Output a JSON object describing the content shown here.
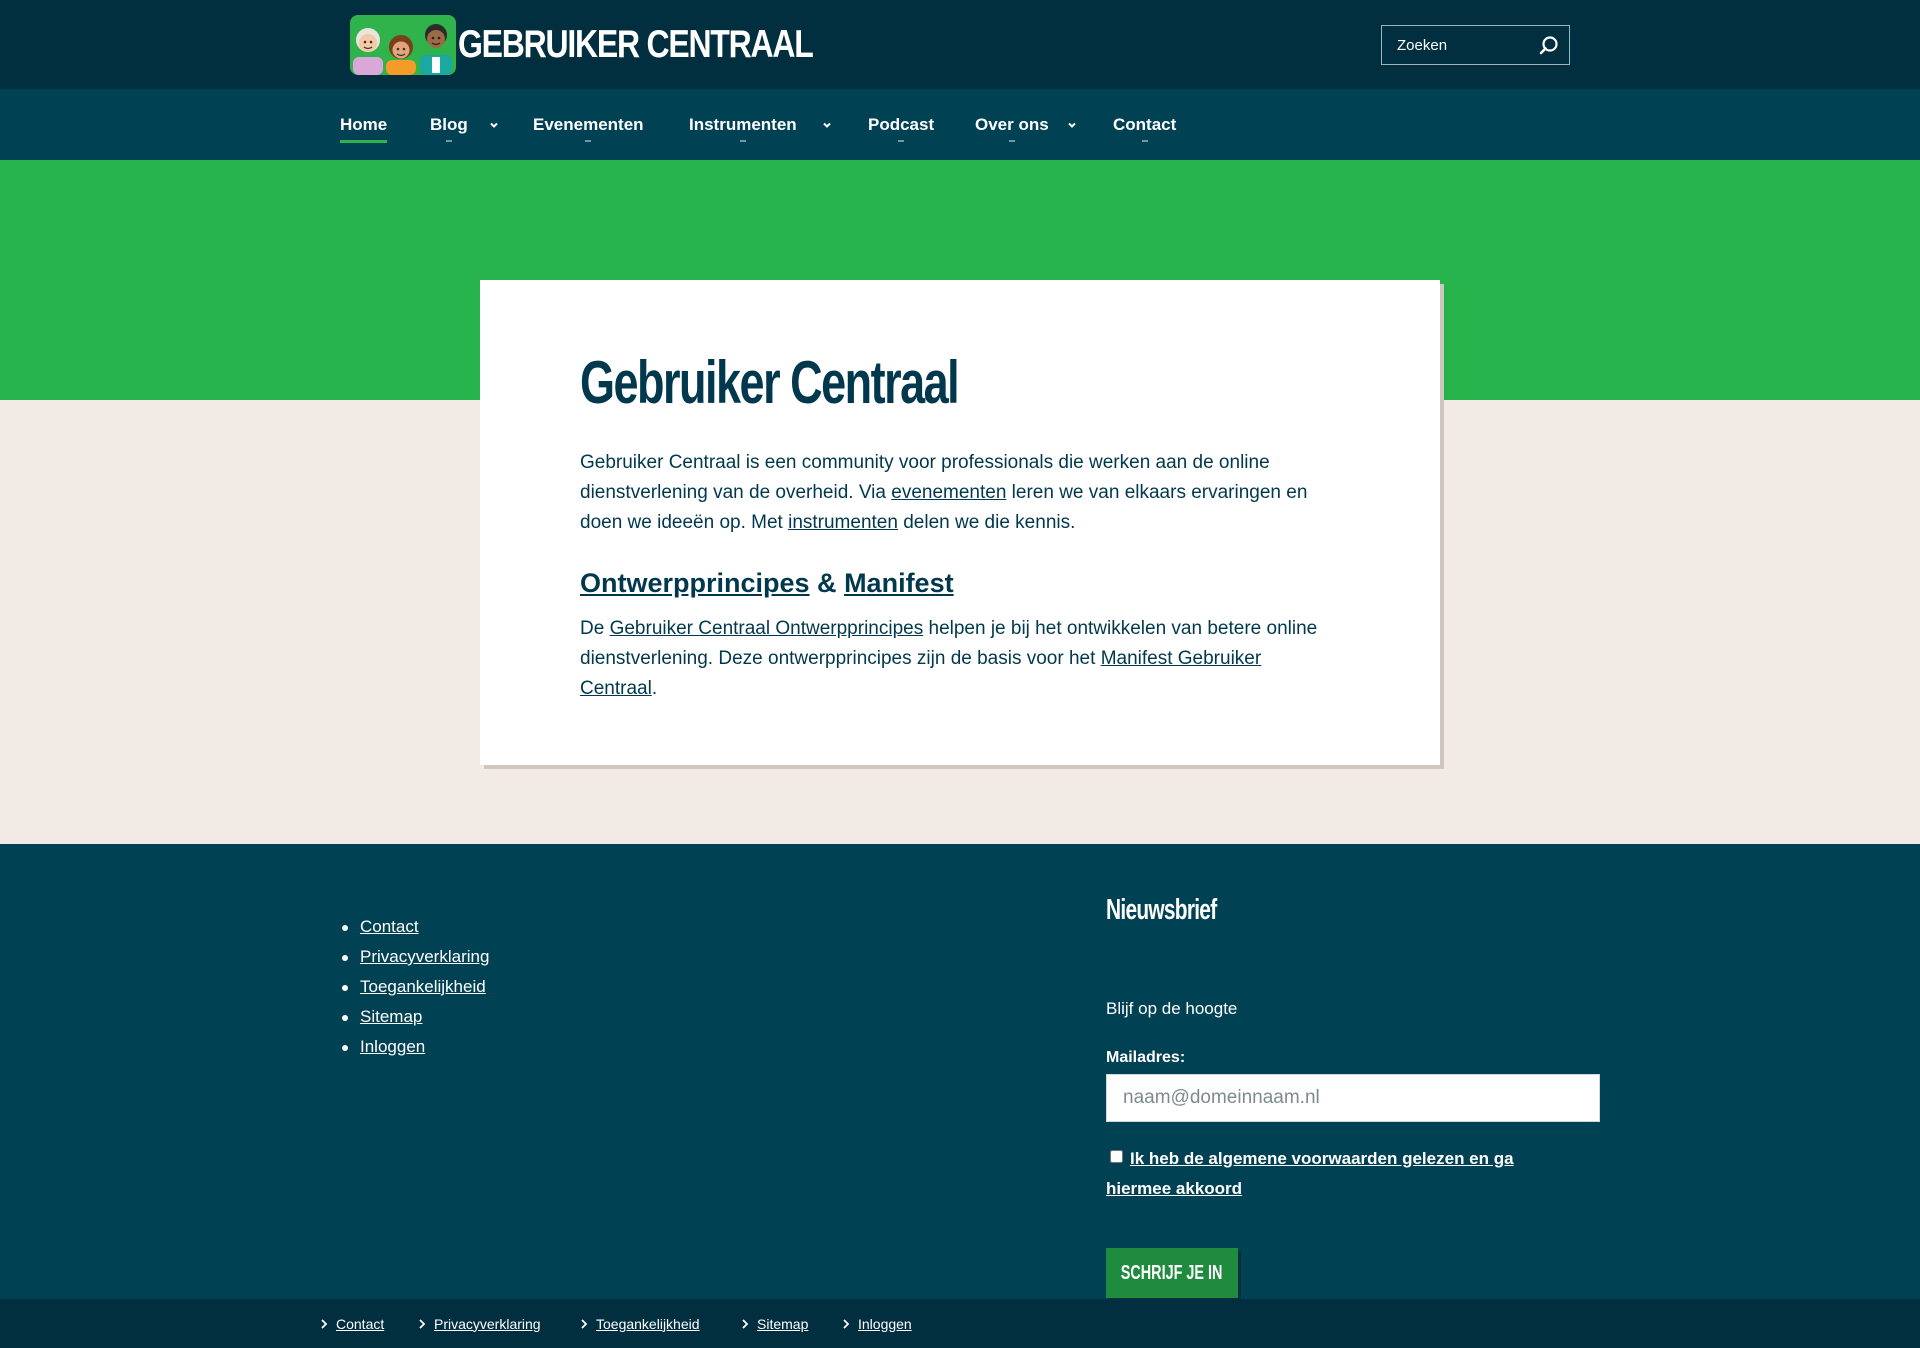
{
  "header": {
    "logo_text": "GEBRUIKER CENTRAAL",
    "search_placeholder": "Zoeken",
    "search_icon": "search-icon"
  },
  "nav": {
    "items": [
      {
        "label": "Home",
        "active": true,
        "has_dropdown": false
      },
      {
        "label": "Blog",
        "active": false,
        "has_dropdown": true
      },
      {
        "label": "Evenementen",
        "active": false,
        "has_dropdown": false
      },
      {
        "label": "Instrumenten",
        "active": false,
        "has_dropdown": true
      },
      {
        "label": "Podcast",
        "active": false,
        "has_dropdown": false
      },
      {
        "label": "Over ons",
        "active": false,
        "has_dropdown": true
      },
      {
        "label": "Contact",
        "active": false,
        "has_dropdown": false
      }
    ]
  },
  "intro": {
    "title": "Gebruiker Centraal",
    "p1_a": "Gebruiker Centraal is een community voor professionals die werken aan de online dienstverlening van de overheid. Via ",
    "p1_link1": "evenementen",
    "p1_b": " leren we van elkaars ervaringen en doen we ideeën op. Met ",
    "p1_link2": "instrumenten",
    "p1_c": " delen we die kennis.",
    "h2_link1": "Ontwerpprincipes",
    "h2_amp": " & ",
    "h2_link2": "Manifest",
    "p2_a": "De ",
    "p2_link1": "Gebruiker Centraal Ontwerpprincipes",
    "p2_b": " helpen je bij het ontwikkelen van betere online dienstverlening. Deze ontwerpprincipes zijn de basis voor het ",
    "p2_link2": "Manifest Gebruiker Centraal",
    "p2_c": "."
  },
  "footer": {
    "links": [
      "Contact",
      "Privacyverklaring",
      "Toegankelijkheid",
      "Sitemap",
      "Inloggen"
    ],
    "newsletter": {
      "title": "Nieuwsbrief",
      "subtitle": "Blijf op de hoogte",
      "email_label": "Mailadres:",
      "email_placeholder": "naam@domeinnaam.nl",
      "terms_label": "Ik heb de algemene voorwaarden gelezen en ga hiermee akkoord",
      "submit_label": "SCHRIJF JE IN"
    },
    "bottom_links": [
      "Contact",
      "Privacyverklaring",
      "Toegankelijkheid",
      "Sitemap",
      "Inloggen"
    ]
  },
  "colors": {
    "dark_blue": "#012f40",
    "nav_blue": "#014154",
    "green": "#26b34c",
    "button_green": "#1e8b3e",
    "beige": "#f2ebe5"
  }
}
